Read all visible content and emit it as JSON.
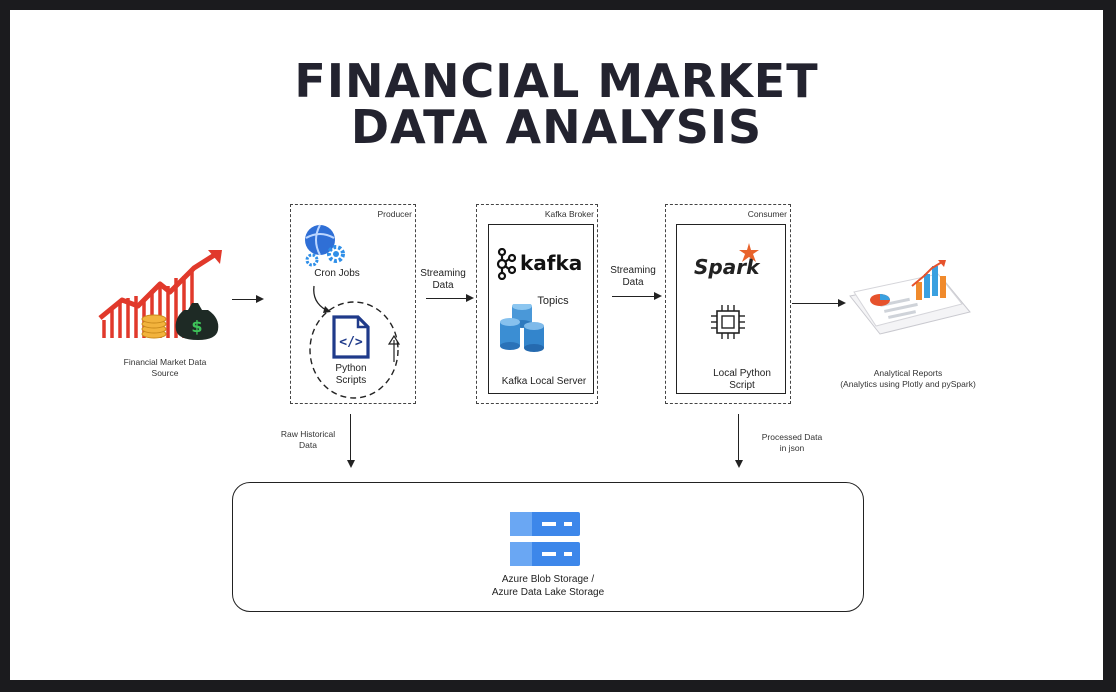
{
  "title": {
    "line1": "FINANCIAL MARKET",
    "line2": "DATA ANALYSIS"
  },
  "source": {
    "label_line1": "Financial Market Data",
    "label_line2": "Source",
    "icon": "stock-chart-money-bag-icon"
  },
  "producer": {
    "box_label": "Producer",
    "cron_label": "Cron Jobs",
    "scripts_line1": "Python",
    "scripts_line2": "Scripts",
    "cron_icon": "globe-gear-icon",
    "script_icon": "code-file-icon"
  },
  "flow1": {
    "line1": "Streaming",
    "line2": "Data"
  },
  "broker": {
    "box_label": "Kafka Broker",
    "logo_text": "kafka",
    "topics_label": "Topics",
    "server_label": "Kafka Local Server",
    "topics_icon": "cylinders-icon"
  },
  "flow2": {
    "line1": "Streaming",
    "line2": "Data"
  },
  "consumer": {
    "box_label": "Consumer",
    "logo_text": "Spark",
    "script_line1": "Local Python",
    "script_line2": "Script",
    "cpu_icon": "cpu-chip-icon"
  },
  "reports": {
    "line1": "Analytical Reports",
    "line2": "(Analytics using Plotly and pySpark)",
    "icon": "report-charts-icon"
  },
  "raw": {
    "line1": "Raw Historical",
    "line2": "Data"
  },
  "processed": {
    "line1": "Processed Data",
    "line2": "in json"
  },
  "storage": {
    "line1": "Azure Blob Storage /",
    "line2": "Azure Data Lake Storage",
    "icon": "server-storage-icon"
  },
  "colors": {
    "title": "#23232f",
    "accent_red": "#e1392b",
    "azure_blue": "#2f6fd6",
    "storage_blue": "#3d87ea",
    "spark_orange": "#e8632b"
  }
}
